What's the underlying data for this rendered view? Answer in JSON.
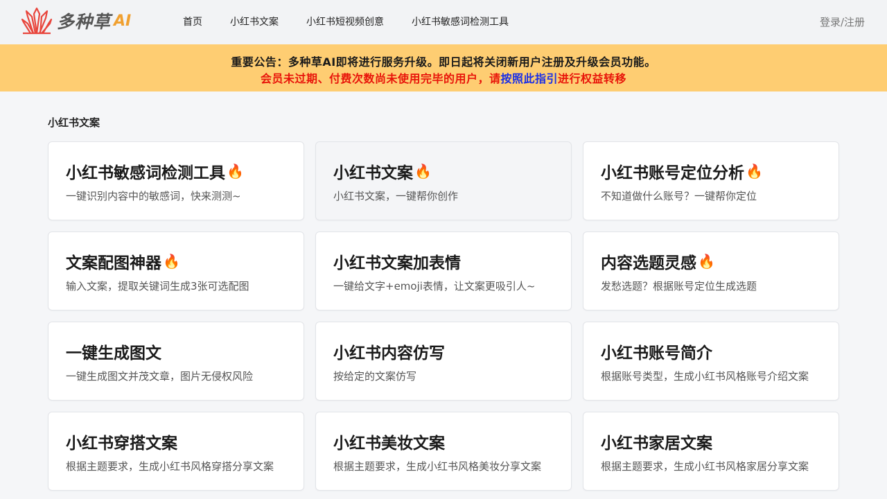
{
  "header": {
    "logo_text": "多种草",
    "logo_ai": "AI",
    "nav": [
      {
        "label": "首页"
      },
      {
        "label": "小红书文案"
      },
      {
        "label": "小红书短视频创意"
      },
      {
        "label": "小红书敏感词检测工具"
      }
    ],
    "login_label": "登录/注册"
  },
  "notice": {
    "line1": "重要公告：多种草AI即将进行服务升级。即日起将关闭新用户注册及升级会员功能。",
    "line2_prefix": "会员未过期、付费次数尚未使用完毕的用户，请",
    "line2_link": "按照此指引",
    "line2_suffix": "进行权益转移"
  },
  "section": {
    "title": "小红书文案"
  },
  "cards": [
    {
      "title": "小红书敏感词检测工具",
      "hot": true,
      "desc": "一键识别内容中的敏感词，快来测测~"
    },
    {
      "title": "小红书文案",
      "hot": true,
      "desc": "小红书文案，一键帮你创作"
    },
    {
      "title": "小红书账号定位分析",
      "hot": true,
      "desc": "不知道做什么账号？一键帮你定位"
    },
    {
      "title": "文案配图神器",
      "hot": true,
      "desc": "输入文案，提取关键词生成3张可选配图"
    },
    {
      "title": "小红书文案加表情",
      "hot": false,
      "desc": "一键给文字+emoji表情，让文案更吸引人~"
    },
    {
      "title": "内容选题灵感",
      "hot": true,
      "desc": "发愁选题？根据账号定位生成选题"
    },
    {
      "title": "一键生成图文",
      "hot": false,
      "desc": "一键生成图文并茂文章，图片无侵权风险"
    },
    {
      "title": "小红书内容仿写",
      "hot": false,
      "desc": "按给定的文案仿写"
    },
    {
      "title": "小红书账号简介",
      "hot": false,
      "desc": "根据账号类型，生成小红书风格账号介绍文案"
    },
    {
      "title": "小红书穿搭文案",
      "hot": false,
      "desc": "根据主题要求，生成小红书风格穿搭分享文案"
    },
    {
      "title": "小红书美妆文案",
      "hot": false,
      "desc": "根据主题要求，生成小红书风格美妆分享文案"
    },
    {
      "title": "小红书家居文案",
      "hot": false,
      "desc": "根据主题要求，生成小红书风格家居分享文案"
    }
  ],
  "colors": {
    "notice_bg": "#fecd72",
    "notice_red": "#e8150a",
    "notice_link": "#1a2ee6",
    "logo_red": "#e8453c",
    "logo_ai": "#f0a030"
  }
}
